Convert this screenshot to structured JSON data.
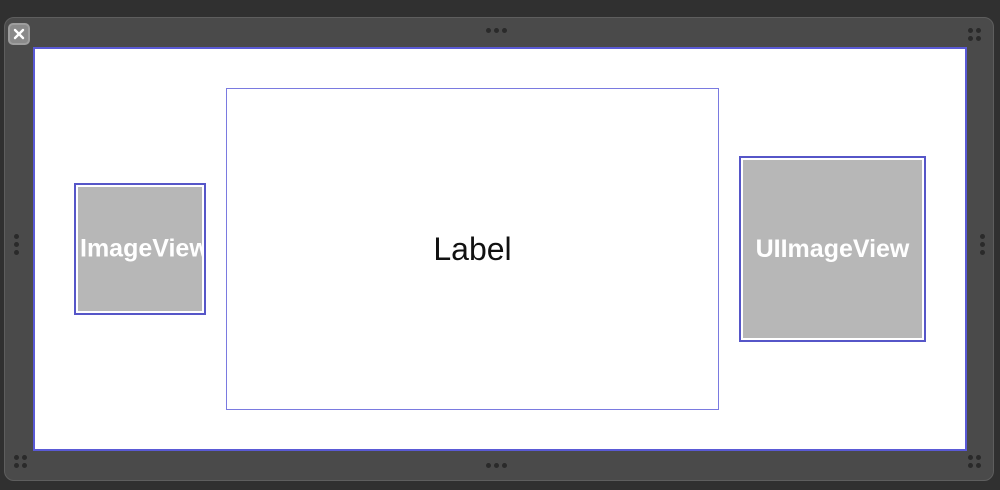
{
  "view_controller": {
    "close_icon": "close-icon",
    "left_image_view": {
      "text": "ImageView"
    },
    "center_label": {
      "text": "Label"
    },
    "right_image_view": {
      "text": "UIImageView"
    }
  },
  "colors": {
    "panel": "#4a4a4a",
    "selection_border": "#5a5ad6",
    "image_view_fill": "#b7b7b7",
    "label_border": "#7a7ae0"
  }
}
